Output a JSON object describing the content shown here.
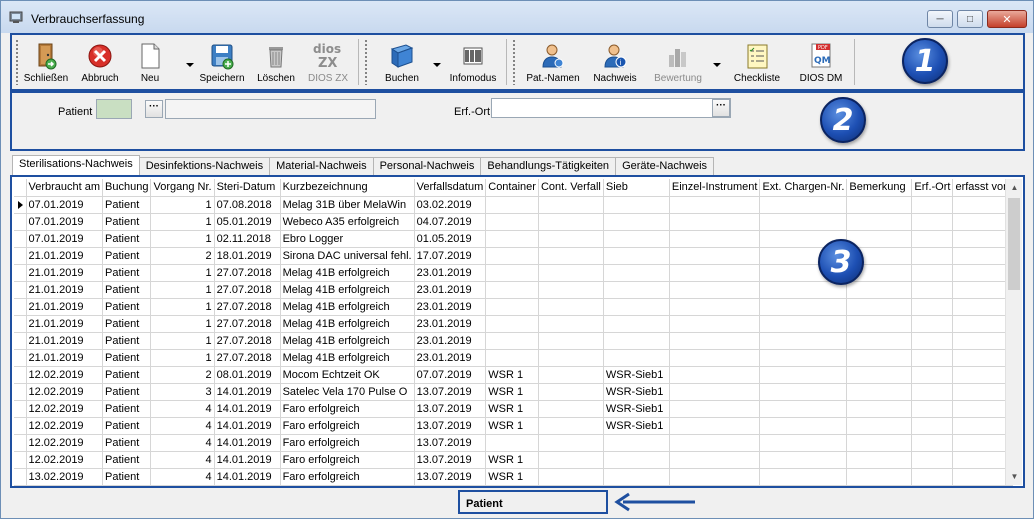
{
  "window": {
    "title": "Verbrauchserfassung"
  },
  "toolbar": {
    "buttons": [
      {
        "label": "Schließen",
        "icon": "door-exit-icon"
      },
      {
        "label": "Abbruch",
        "icon": "red-cancel-icon"
      },
      {
        "label": "Neu",
        "icon": "new-document-icon"
      },
      {
        "label": "Speichern",
        "icon": "save-disk-icon"
      },
      {
        "label": "Löschen",
        "icon": "trash-can-icon"
      },
      {
        "label": "DIOS ZX",
        "icon": "dios-zx-logo-icon"
      },
      {
        "label": "Buchen",
        "icon": "book-icon"
      },
      {
        "label": "Infomodus",
        "icon": "barcode-scanner-icon"
      },
      {
        "label": "Pat.-Namen",
        "icon": "patient-user-icon"
      },
      {
        "label": "Nachweis",
        "icon": "verification-user-icon"
      },
      {
        "label": "Bewertung",
        "icon": "rating-chart-icon"
      },
      {
        "label": "Checkliste",
        "icon": "checklist-icon"
      },
      {
        "label": "DIOS DM",
        "icon": "dios-dm-pdf-icon"
      }
    ]
  },
  "badges": [
    "1",
    "2",
    "3"
  ],
  "filter": {
    "patient_label": "Patient",
    "patient_value": "",
    "patient_name": "",
    "erfort_label": "Erf.-Ort",
    "erfort_value": ""
  },
  "tabs": [
    "Sterilisations-Nachweis",
    "Desinfektions-Nachweis",
    "Material-Nachweis",
    "Personal-Nachweis",
    "Behandlungs-Tätigkeiten",
    "Geräte-Nachweis"
  ],
  "table": {
    "columns": [
      "Verbraucht am",
      "Buchung",
      "Vorgang Nr.",
      "Steri-Datum",
      "Kurzbezeichnung",
      "Verfallsdatum",
      "Container",
      "Cont. Verfall",
      "Sieb",
      "Einzel-Instrument",
      "Ext. Chargen-Nr.",
      "Bemerkung",
      "Erf.-Ort",
      "erfasst von"
    ],
    "rows": [
      [
        "07.01.2019",
        "Patient",
        "1",
        "07.08.2018",
        "Melag 31B über MelaWin",
        "03.02.2019",
        "",
        "",
        "",
        "",
        "",
        "",
        "",
        ""
      ],
      [
        "07.01.2019",
        "Patient",
        "1",
        "05.01.2019",
        "Webeco A35 erfolgreich",
        "04.07.2019",
        "",
        "",
        "",
        "",
        "",
        "",
        "",
        ""
      ],
      [
        "07.01.2019",
        "Patient",
        "1",
        "02.11.2018",
        "Ebro Logger",
        "01.05.2019",
        "",
        "",
        "",
        "",
        "",
        "",
        "",
        ""
      ],
      [
        "21.01.2019",
        "Patient",
        "2",
        "18.01.2019",
        "Sirona DAC universal fehl.",
        "17.07.2019",
        "",
        "",
        "",
        "",
        "",
        "",
        "",
        ""
      ],
      [
        "21.01.2019",
        "Patient",
        "1",
        "27.07.2018",
        "Melag 41B erfolgreich",
        "23.01.2019",
        "",
        "",
        "",
        "",
        "",
        "",
        "",
        ""
      ],
      [
        "21.01.2019",
        "Patient",
        "1",
        "27.07.2018",
        "Melag 41B erfolgreich",
        "23.01.2019",
        "",
        "",
        "",
        "",
        "",
        "",
        "",
        ""
      ],
      [
        "21.01.2019",
        "Patient",
        "1",
        "27.07.2018",
        "Melag 41B erfolgreich",
        "23.01.2019",
        "",
        "",
        "",
        "",
        "",
        "",
        "",
        ""
      ],
      [
        "21.01.2019",
        "Patient",
        "1",
        "27.07.2018",
        "Melag 41B erfolgreich",
        "23.01.2019",
        "",
        "",
        "",
        "",
        "",
        "",
        "",
        ""
      ],
      [
        "21.01.2019",
        "Patient",
        "1",
        "27.07.2018",
        "Melag 41B erfolgreich",
        "23.01.2019",
        "",
        "",
        "",
        "",
        "",
        "",
        "",
        ""
      ],
      [
        "21.01.2019",
        "Patient",
        "1",
        "27.07.2018",
        "Melag 41B erfolgreich",
        "23.01.2019",
        "",
        "",
        "",
        "",
        "",
        "",
        "",
        ""
      ],
      [
        "12.02.2019",
        "Patient",
        "2",
        "08.01.2019",
        "Mocom Echtzeit OK",
        "07.07.2019",
        "WSR 1",
        "",
        "WSR-Sieb1",
        "",
        "",
        "",
        "",
        ""
      ],
      [
        "12.02.2019",
        "Patient",
        "3",
        "14.01.2019",
        "Satelec Vela 170 Pulse O",
        "13.07.2019",
        "WSR 1",
        "",
        "WSR-Sieb1",
        "",
        "",
        "",
        "",
        ""
      ],
      [
        "12.02.2019",
        "Patient",
        "4",
        "14.01.2019",
        "Faro erfolgreich",
        "13.07.2019",
        "WSR 1",
        "",
        "WSR-Sieb1",
        "",
        "",
        "",
        "",
        ""
      ],
      [
        "12.02.2019",
        "Patient",
        "4",
        "14.01.2019",
        "Faro erfolgreich",
        "13.07.2019",
        "WSR 1",
        "",
        "WSR-Sieb1",
        "",
        "",
        "",
        "",
        ""
      ],
      [
        "12.02.2019",
        "Patient",
        "4",
        "14.01.2019",
        "Faro erfolgreich",
        "13.07.2019",
        "",
        "",
        "",
        "",
        "",
        "",
        "",
        ""
      ],
      [
        "12.02.2019",
        "Patient",
        "4",
        "14.01.2019",
        "Faro erfolgreich",
        "13.07.2019",
        "WSR 1",
        "",
        "",
        "",
        "",
        "",
        "",
        ""
      ],
      [
        "13.02.2019",
        "Patient",
        "4",
        "14.01.2019",
        "Faro erfolgreich",
        "13.07.2019",
        "WSR 1",
        "",
        "",
        "",
        "",
        "",
        "",
        ""
      ]
    ]
  },
  "status": {
    "mode": "Patient"
  },
  "colors": {
    "frame_blue": "#1e4fa0",
    "patient_field_green": "#c9dfc2"
  }
}
